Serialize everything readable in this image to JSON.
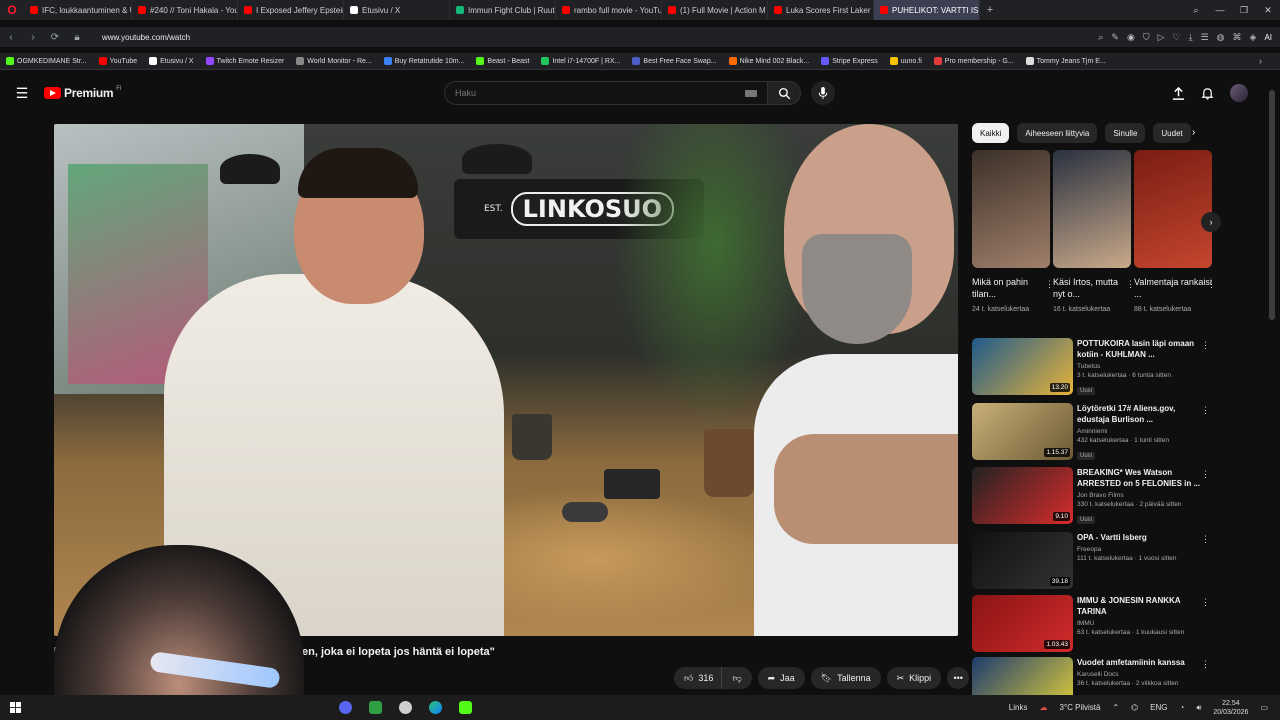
{
  "browser": {
    "tabs": [
      {
        "label": "IFC, loukkaantuminen & U",
        "color": "#ff0000"
      },
      {
        "label": "#240 // Toni Hakala - You",
        "color": "#ff0000"
      },
      {
        "label": "I Exposed Jeffery Epstein's",
        "color": "#ff0000"
      },
      {
        "label": "Etusivu / X",
        "color": "#ffffff"
      },
      {
        "label": "Immun Fight Club | Ruutu",
        "color": "#14b87a"
      },
      {
        "label": "rambo full movie - YouTu",
        "color": "#ff0000"
      },
      {
        "label": "(1) Full Movie | Action M",
        "color": "#ff0000"
      },
      {
        "label": "Luka Scores First Laker 60",
        "color": "#ff0000"
      },
      {
        "label": "PUHELIKOT: VARTTI IS",
        "color": "#ff0000"
      }
    ],
    "url": "www.youtube.com/watch",
    "ai_label": "AI",
    "bookmarks": [
      {
        "label": "OGMKEDIMANE Str...",
        "color": "#53fc18"
      },
      {
        "label": "YouTube",
        "color": "#ff0000"
      },
      {
        "label": "Etusivu / X",
        "color": "#ffffff"
      },
      {
        "label": "Twitch Emote Resizer",
        "color": "#9146ff"
      },
      {
        "label": "World Monitor - Re...",
        "color": "#888888"
      },
      {
        "label": "Buy Retatrutide 10m...",
        "color": "#3b82f6"
      },
      {
        "label": "Beast - Beast",
        "color": "#53fc18"
      },
      {
        "label": "Intel i7-14700F | RX...",
        "color": "#22c55e"
      },
      {
        "label": "Best Free Face Swap...",
        "color": "#4b5cc4"
      },
      {
        "label": "Nike Mind 002 Black...",
        "color": "#ff6a00"
      },
      {
        "label": "Stripe Express",
        "color": "#635bff"
      },
      {
        "label": "uuno.fi",
        "color": "#f5c400"
      },
      {
        "label": "Pro membership - G...",
        "color": "#e33b3b"
      },
      {
        "label": "Tommy Jeans Tjm E...",
        "color": "#dddddd"
      }
    ]
  },
  "youtube": {
    "brand": "Premium",
    "region": "FI",
    "search_placeholder": "Haku"
  },
  "video": {
    "sign_est": "EST.",
    "sign_name": "LINKOSUO",
    "title_left": "F",
    "title": "en, joka ei lopeta jos häntä ei lopeta\"",
    "likes": "316",
    "share_label": "Jaa",
    "save_label": "Tallenna",
    "clip_label": "Klippi"
  },
  "chips": [
    "Kaikki",
    "Aiheeseen liittyvia",
    "Sinulle",
    "Uudet"
  ],
  "shorts": [
    {
      "title": "Mikä on pahin tilan...",
      "views": "24 t. katselukertaa",
      "colors": [
        "#3b3028",
        "#a07f6b"
      ]
    },
    {
      "title": "Käsi Irtos, mutta nyt o...",
      "views": "16 t. katselukertaa",
      "colors": [
        "#2a3140",
        "#c9a98a"
      ]
    },
    {
      "title": "Valmentaja rankaisi ...",
      "views": "88 t. katselukertaa",
      "colors": [
        "#7a1d12",
        "#c4462f"
      ]
    }
  ],
  "recommendations": [
    {
      "title": "POTTUKOIRA lasin läpi omaan kotiin - KUHLMAN ...",
      "channel": "Tubetus",
      "meta": "3 t. katselukertaa · 6 tuntia sitten",
      "badge": "Uusi",
      "duration": "13.20",
      "colors": [
        "#1d5a8c",
        "#e8b33a"
      ]
    },
    {
      "title": "Löytöretki 17# Aliens.gov, edustaja Burlison ...",
      "channel": "Aminniemi",
      "meta": "432 katselukertaa · 1 tunti sitten",
      "badge": "Uusi",
      "duration": "1.15.37",
      "colors": [
        "#c8b07a",
        "#6d5a33"
      ]
    },
    {
      "title": "BREAKING* Wes Watson ARRESTED on 5 FELONIES in ...",
      "channel": "Jon Bravo Films",
      "meta": "330 t. katselukertaa · 2 päivää sitten",
      "badge": "Uusi",
      "duration": "9.10",
      "colors": [
        "#222222",
        "#d92b2b"
      ]
    },
    {
      "title": "OPA - Vartti Isberg",
      "channel": "Freeopa",
      "meta": "111 t. katselukertaa · 1 vuosi sitten",
      "badge": "",
      "duration": "39.18",
      "colors": [
        "#111111",
        "#333333"
      ]
    },
    {
      "title": "IMMU & JONESIN RANKKA TARINA",
      "channel": "IMMU",
      "meta": "63 t. katselukertaa · 1 kuukausi sitten",
      "badge": "",
      "duration": "1.03.43",
      "colors": [
        "#8a1414",
        "#d12b2b"
      ]
    },
    {
      "title": "Vuodet amfetamiinin kanssa",
      "channel": "Karuselli Docs",
      "meta": "36 t. katselukertaa · 2 viikkoa sitten",
      "badge": "",
      "duration": "",
      "colors": [
        "#1d3a6e",
        "#e3d23a"
      ]
    }
  ],
  "taskbar": {
    "links_label": "Links",
    "weather": "3°C Pilvistä",
    "lang": "ENG",
    "time": "22.54",
    "date": "20/03/2026"
  }
}
